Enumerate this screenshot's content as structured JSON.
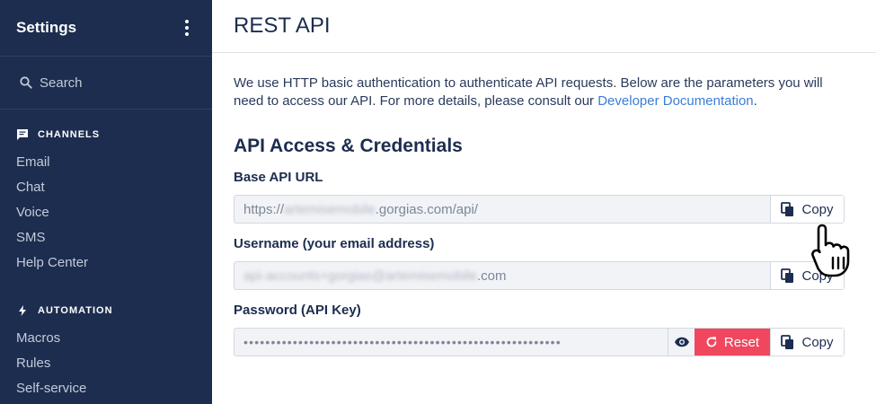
{
  "sidebar": {
    "title": "Settings",
    "search_label": "Search",
    "sections": [
      {
        "label": "CHANNELS",
        "icon": "chat-bubble-icon",
        "items": [
          "Email",
          "Chat",
          "Voice",
          "SMS",
          "Help Center"
        ]
      },
      {
        "label": "AUTOMATION",
        "icon": "lightning-icon",
        "items": [
          "Macros",
          "Rules",
          "Self-service"
        ]
      }
    ]
  },
  "header": {
    "title": "REST API"
  },
  "intro": {
    "text": "We use HTTP basic authentication to authenticate API requests. Below are the parameters you will need to access our API. For more details, please consult our ",
    "link": "Developer Documentation",
    "suffix": "."
  },
  "credentials": {
    "title": "API Access & Credentials",
    "base_url": {
      "label": "Base API URL",
      "prefix": "https://",
      "hidden": "artemisemobile",
      "suffix": ".gorgias.com/api/",
      "copy_label": "Copy"
    },
    "username": {
      "label": "Username (your email address)",
      "hidden": "api-accounts+gorgias@artemisemobile",
      "suffix": ".com",
      "copy_label": "Copy"
    },
    "password": {
      "label": "Password (API Key)",
      "masked": "••••••••••••••••••••••••••••••••••••••••••••••••••••••••••",
      "reset_label": "Reset",
      "copy_label": "Copy"
    }
  },
  "colors": {
    "sidebar_bg": "#1c2d4f",
    "accent_link": "#3b7dd8",
    "danger": "#f0475e"
  }
}
